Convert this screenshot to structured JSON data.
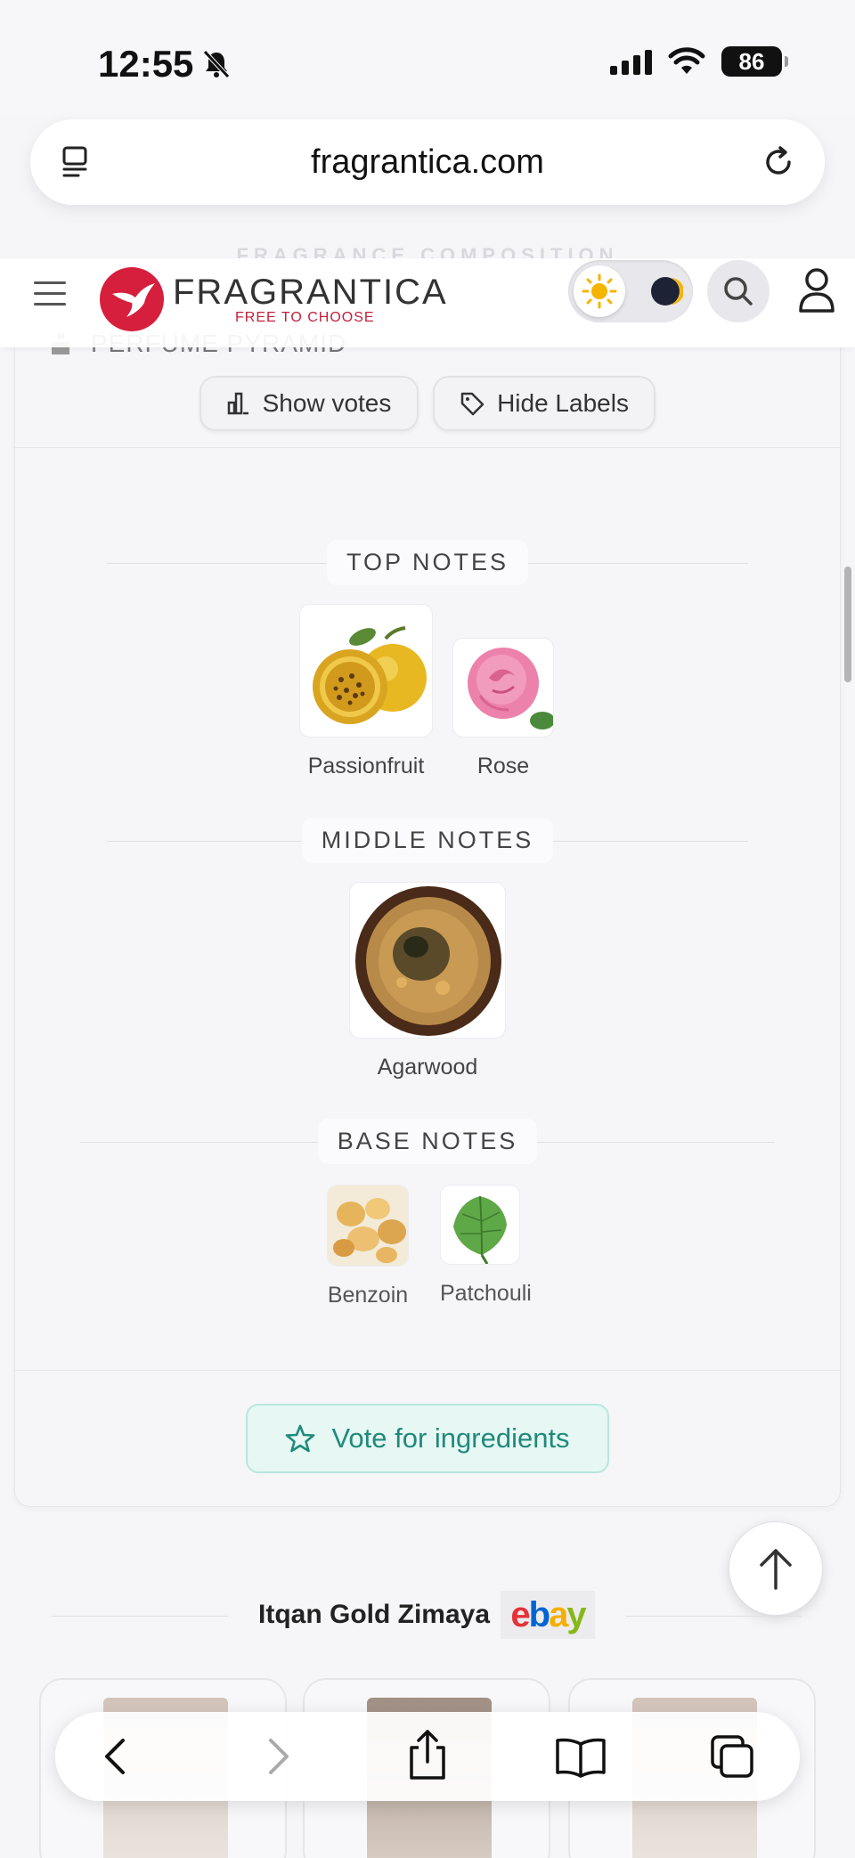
{
  "status": {
    "time": "12:55",
    "battery": "86"
  },
  "browser": {
    "url": "fragrantica.com"
  },
  "header": {
    "ghost_section_title": "FRAGRANCE COMPOSITION",
    "logo_text": "FRAGRANTICA",
    "logo_tagline": "FREE TO CHOOSE"
  },
  "pyramid": {
    "title": "PERFUME PYRAMID",
    "show_votes_label": "Show votes",
    "hide_labels_label": "Hide Labels"
  },
  "notes": {
    "top": {
      "label": "TOP NOTES",
      "items": [
        {
          "name": "Passionfruit",
          "icon": "passionfruit-image"
        },
        {
          "name": "Rose",
          "icon": "rose-image"
        }
      ]
    },
    "middle": {
      "label": "MIDDLE NOTES",
      "items": [
        {
          "name": "Agarwood",
          "icon": "agarwood-image"
        }
      ]
    },
    "base": {
      "label": "BASE NOTES",
      "items": [
        {
          "name": "Benzoin",
          "icon": "benzoin-image"
        },
        {
          "name": "Patchouli",
          "icon": "patchouli-image"
        }
      ]
    }
  },
  "vote_button": {
    "label": "Vote for ingredients"
  },
  "ebay_section": {
    "product_name": "Itqan Gold Zimaya",
    "store_logo": "ebay"
  },
  "colors": {
    "brand_red": "#d61f3c",
    "vote_teal": "#1f8a7a",
    "ebay_red": "#e53238",
    "ebay_blue": "#0064d2",
    "ebay_yellow": "#f5af02",
    "ebay_green": "#86b817"
  }
}
